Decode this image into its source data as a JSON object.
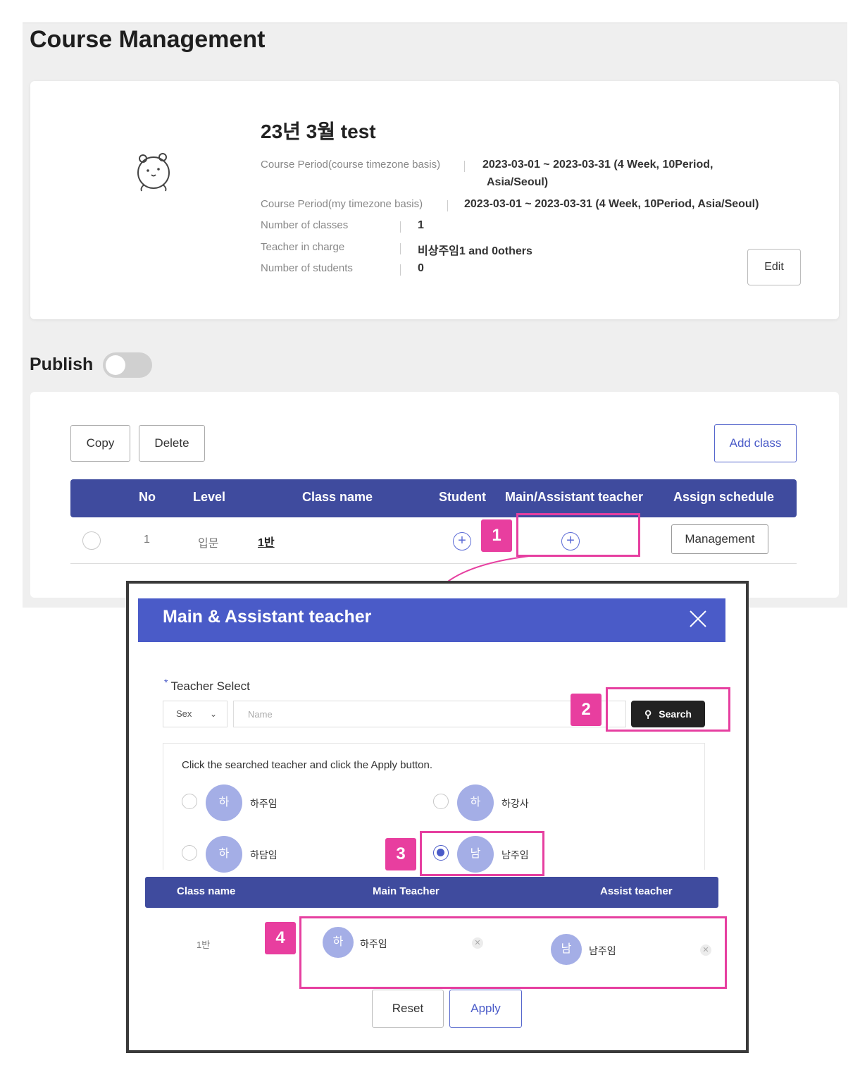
{
  "page": {
    "title": "Course Management"
  },
  "course": {
    "name": "23년 3월 test",
    "info": [
      {
        "label": "Course Period(course timezone basis)",
        "value": "2023-03-01 ~ 2023-03-31  (4 Week,  10Period,",
        "value_cont": "Asia/Seoul)"
      },
      {
        "label": "Course Period(my timezone basis)",
        "value": "2023-03-01 ~ 2023-03-31  (4 Week,  10Period,  Asia/Seoul)"
      },
      {
        "label": "Number of classes",
        "value": "1"
      },
      {
        "label": "Teacher in charge",
        "value": "비상주임1 and 0others"
      },
      {
        "label": "Number of students",
        "value": "0"
      }
    ],
    "edit_label": "Edit"
  },
  "publish": {
    "label": "Publish",
    "enabled": false
  },
  "class_panel": {
    "copy_label": "Copy",
    "delete_label": "Delete",
    "add_class_label": "Add class",
    "columns": [
      "No",
      "Level",
      "Class name",
      "Student",
      "Main/Assistant teacher",
      "Assign schedule"
    ],
    "rows": [
      {
        "no": "1",
        "level": "입문",
        "class_name": "1반",
        "management_label": "Management"
      }
    ]
  },
  "markers": [
    "1",
    "2",
    "3",
    "4"
  ],
  "modal": {
    "title": "Main & Assistant teacher",
    "required_mark": "*",
    "teacher_select_label": "Teacher Select",
    "sex_value": "Sex",
    "name_placeholder": "Name",
    "search_label": "Search",
    "hint": "Click the searched teacher and click the Apply button.",
    "teachers": [
      {
        "avatar": "하",
        "name": "하주임",
        "selected": false
      },
      {
        "avatar": "하",
        "name": "하강사",
        "selected": false
      },
      {
        "avatar": "하",
        "name": "하담임",
        "selected": false
      },
      {
        "avatar": "남",
        "name": "남주임",
        "selected": true
      }
    ],
    "assign_columns": [
      "Class name",
      "Main Teacher",
      "Assist teacher"
    ],
    "assignment": {
      "class_name": "1반",
      "main": {
        "avatar": "하",
        "name": "하주임"
      },
      "assist": {
        "avatar": "남",
        "name": "남주임"
      }
    },
    "reset_label": "Reset",
    "apply_label": "Apply"
  },
  "colors": {
    "header_blue": "#3f4b9e",
    "modal_blue": "#4a5bc8",
    "marker_pink": "#e63fa0",
    "avatar": "#a4aee6"
  }
}
